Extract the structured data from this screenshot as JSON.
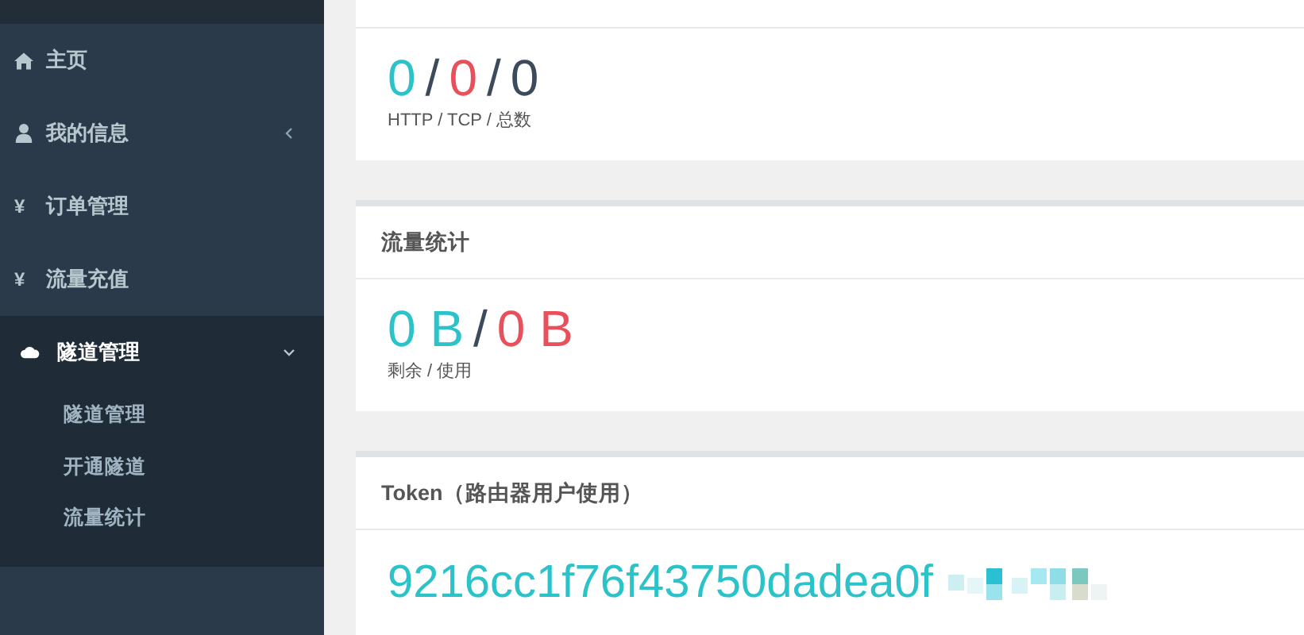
{
  "sidebar": {
    "items": [
      {
        "kind": "link",
        "label": "主页"
      },
      {
        "kind": "group",
        "label": "我的信息",
        "expanded": false
      },
      {
        "kind": "link",
        "icon_char": "¥",
        "label": "订单管理"
      },
      {
        "kind": "link",
        "icon_char": "¥",
        "label": "流量充值"
      },
      {
        "kind": "group",
        "label": "隧道管理",
        "expanded": true,
        "children": [
          {
            "label": "隧道管理"
          },
          {
            "label": "开通隧道"
          },
          {
            "label": "流量统计"
          }
        ]
      }
    ]
  },
  "cards": [
    {
      "kind": "stats",
      "parts": [
        {
          "text": "0",
          "color": "#2bc3c9"
        },
        {
          "text": "/",
          "color": "#3d4a5c"
        },
        {
          "text": "0",
          "color": "#e8505b"
        },
        {
          "text": "/",
          "color": "#3d4a5c"
        },
        {
          "text": "0",
          "color": "#3d4a5c"
        }
      ],
      "caption": "HTTP / TCP / 总数"
    },
    {
      "kind": "stats",
      "title": "流量统计",
      "parts": [
        {
          "text": "0 B",
          "color": "#2bc3c9"
        },
        {
          "text": "/",
          "color": "#3d4a5c"
        },
        {
          "text": "0 B",
          "color": "#e8505b"
        }
      ],
      "caption": "剩余 / 使用"
    },
    {
      "kind": "token",
      "title": "Token（路由器用户使用）",
      "value": "9216cc1f76f43750dadea0f"
    }
  ]
}
